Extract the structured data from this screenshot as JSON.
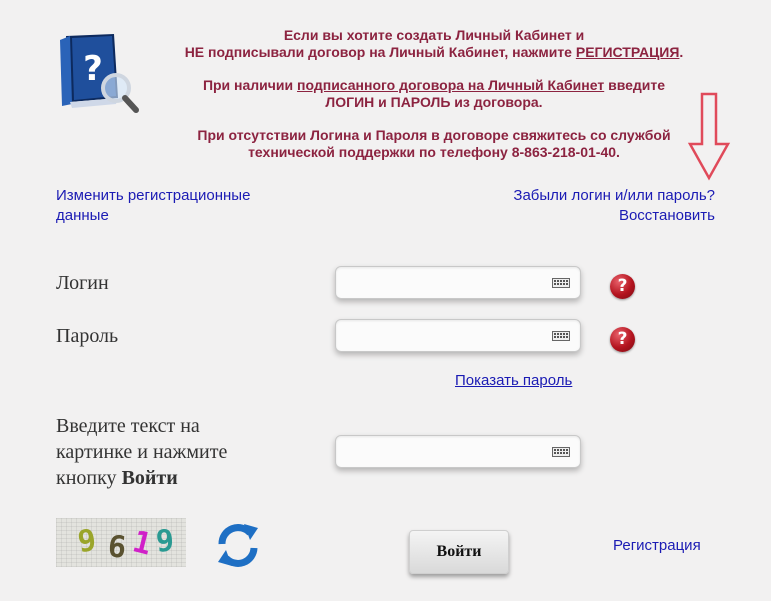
{
  "info": {
    "line1a": "Если вы хотите создать Личный Кабинет и",
    "line1b_pre": "НЕ подписывали договор на Личный Кабинет, нажмите ",
    "line1b_link": "РЕГИСТРАЦИЯ",
    "line1b_post": ".",
    "line2_pre": "При наличии ",
    "line2_link": "подписанного договора на Личный Кабинет",
    "line2_post": " введите",
    "line2b": "ЛОГИН и ПАРОЛЬ из договора.",
    "line3a": "При отсутствии Логина и Пароля в договоре свяжитесь со службой",
    "line3b": "технической поддержки по телефону 8-863-218-01-40."
  },
  "links": {
    "change_reg_1": "Изменить регистрационные",
    "change_reg_2": "данные",
    "forgot": "Забыли логин и/или пароль?",
    "restore": "Восстановить",
    "show_password": "Показать пароль",
    "registration": "Регистрация"
  },
  "form": {
    "login_label": "Логин",
    "password_label": "Пароль",
    "captcha_label_1": "Введите текст на",
    "captcha_label_2": "картинке и нажмите",
    "captcha_label_3": "кнопку ",
    "captcha_label_bold": "Войти",
    "login_value": "",
    "password_value": "",
    "captcha_value": ""
  },
  "captcha": {
    "digits": [
      "9",
      "6",
      "1",
      "9"
    ]
  },
  "submit_label": "Войти",
  "icons": {
    "help": "question-mark-help-icon",
    "keyboard": "keyboard-icon",
    "refresh": "refresh-icon",
    "book": "help-book-icon",
    "arrow": "down-arrow-icon"
  },
  "colors": {
    "accent": "#8c2340",
    "link": "#1b1bb4",
    "arrow": "#e04a5a"
  }
}
